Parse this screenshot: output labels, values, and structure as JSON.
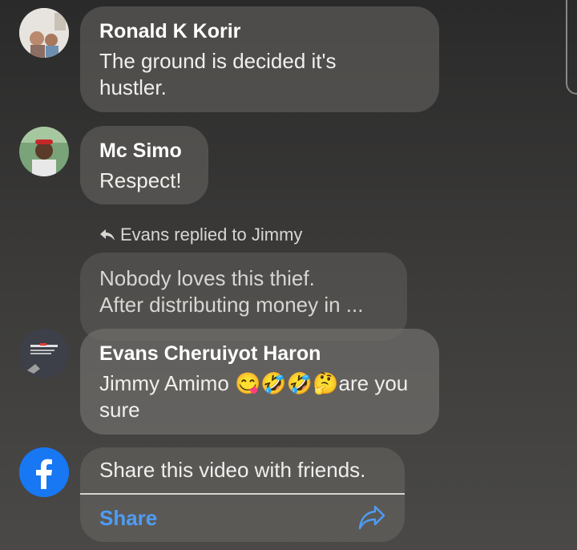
{
  "comments": [
    {
      "name": "Ronald K Korir",
      "text": "The ground is decided it's hustler."
    },
    {
      "name": "Mc Simo",
      "text": "Respect!"
    },
    {
      "name": "Evans Cheruiyot Haron",
      "text": "Jimmy Amimo",
      "emoji": "😋🤣🤣🤔",
      "text_after": "are you sure"
    }
  ],
  "reply": {
    "indicator": "Evans replied to Jimmy",
    "quoted_line1": "Nobody loves this thief.",
    "quoted_line2": "After distributing money in ..."
  },
  "share": {
    "prompt": "Share this video with friends.",
    "link": "Share"
  },
  "colors": {
    "accent": "#4e9cf5",
    "facebook": "#1877f2"
  }
}
